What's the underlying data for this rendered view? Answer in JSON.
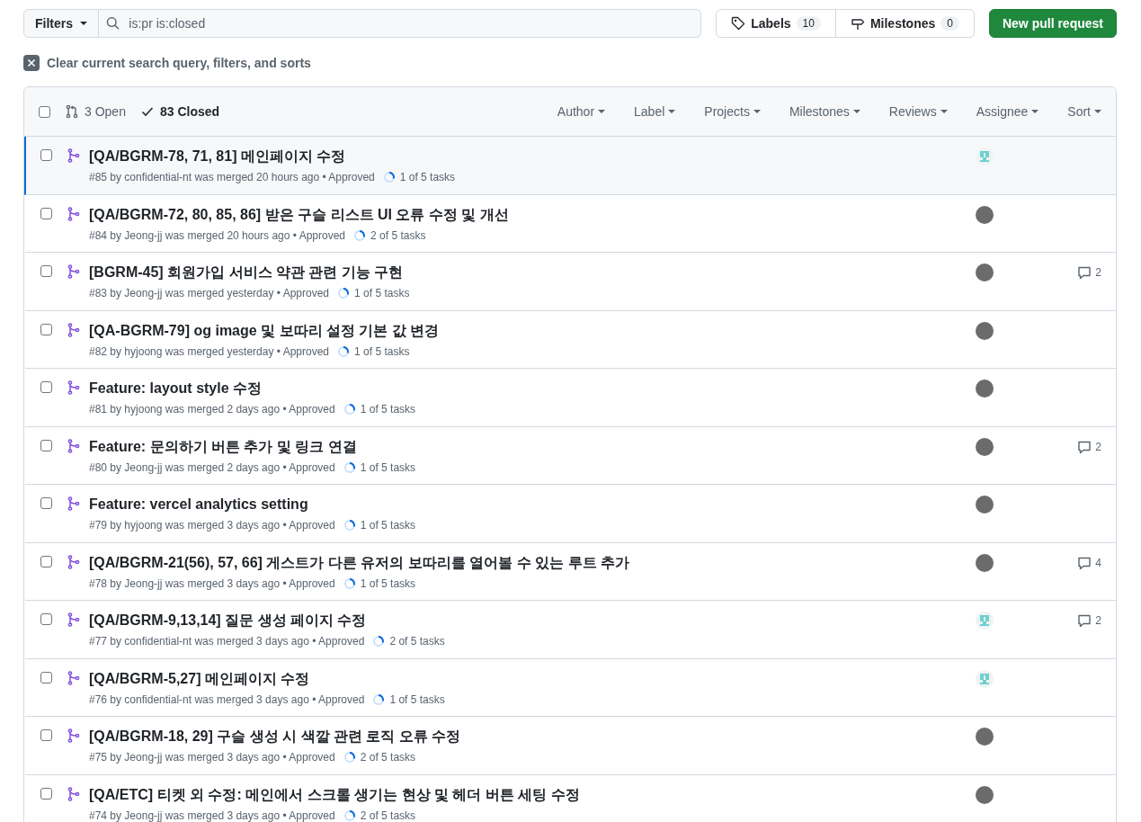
{
  "toolbar": {
    "filters_button": "Filters",
    "search": {
      "value": "is:pr is:closed"
    },
    "labels": {
      "label": "Labels",
      "count": "10"
    },
    "milestones": {
      "label": "Milestones",
      "count": "0"
    },
    "new_button": "New pull request"
  },
  "clear_filters": "Clear current search query, filters, and sorts",
  "list_header": {
    "checked": false,
    "states": [
      {
        "label": "3 Open",
        "selected": false
      },
      {
        "label": "83 Closed",
        "selected": true
      }
    ],
    "filters": [
      "Author",
      "Label",
      "Projects",
      "Milestones",
      "Reviews",
      "Assignee",
      "Sort"
    ]
  },
  "rows": [
    {
      "title": "[QA/BGRM-78, 71, 81] 메인페이지 수정",
      "meta": "#85 by confidential-nt was merged 20 hours ago • Approved",
      "tasks": "1 of 5 tasks",
      "kind": "identicon",
      "checked": false,
      "selected": true
    },
    {
      "title": "[QA/BGRM-72, 80, 85, 86] 받은 구슬 리스트 UI 오류 수정 및 개선",
      "meta": "#84 by Jeong-jj was merged 20 hours ago • Approved",
      "tasks": "2 of 5 tasks",
      "kind": "photo",
      "checked": false,
      "selected": false
    },
    {
      "title": "[BGRM-45] 회원가입 서비스 약관 관련 기능 구현",
      "meta": "#83 by Jeong-jj was merged yesterday • Approved",
      "tasks": "1 of 5 tasks",
      "kind": "photo",
      "comments": "2",
      "checked": false,
      "selected": false
    },
    {
      "title": "[QA-BGRM-79] og image 및 보따리 설정 기본 값 변경",
      "meta": "#82 by hyjoong was merged yesterday • Approved",
      "tasks": "1 of 5 tasks",
      "kind": "photo",
      "checked": false,
      "selected": false
    },
    {
      "title": "Feature: layout style 수정",
      "meta": "#81 by hyjoong was merged 2 days ago • Approved",
      "tasks": "1 of 5 tasks",
      "kind": "photo",
      "checked": false,
      "selected": false
    },
    {
      "title": "Feature: 문의하기 버튼 추가 및 링크 연결",
      "meta": "#80 by Jeong-jj was merged 2 days ago • Approved",
      "tasks": "1 of 5 tasks",
      "kind": "photo",
      "comments": "2",
      "checked": false,
      "selected": false
    },
    {
      "title": "Feature: vercel analytics setting",
      "meta": "#79 by hyjoong was merged 3 days ago • Approved",
      "tasks": "1 of 5 tasks",
      "kind": "photo",
      "checked": false,
      "selected": false
    },
    {
      "title": "[QA/BGRM-21(56), 57, 66] 게스트가 다른 유저의 보따리를 열어볼 수 있는 루트 추가",
      "meta": "#78 by Jeong-jj was merged 3 days ago • Approved",
      "tasks": "1 of 5 tasks",
      "kind": "photo",
      "comments": "4",
      "checked": false,
      "selected": false
    },
    {
      "title": "[QA/BGRM-9,13,14] 질문 생성 페이지 수정",
      "meta": "#77 by confidential-nt was merged 3 days ago • Approved",
      "tasks": "2 of 5 tasks",
      "kind": "identicon",
      "comments": "2",
      "checked": false,
      "selected": false
    },
    {
      "title": "[QA/BGRM-5,27] 메인페이지 수정",
      "meta": "#76 by confidential-nt was merged 3 days ago • Approved",
      "tasks": "1 of 5 tasks",
      "kind": "identicon",
      "checked": false,
      "selected": false
    },
    {
      "title": "[QA/BGRM-18, 29] 구슬 생성 시 색깔 관련 로직 오류 수정",
      "meta": "#75 by Jeong-jj was merged 3 days ago • Approved",
      "tasks": "2 of 5 tasks",
      "kind": "photo",
      "checked": false,
      "selected": false
    },
    {
      "title": "[QA/ETC] 티켓 외 수정: 메인에서 스크롤 생기는 현상 및 헤더 버튼 세팅 수정",
      "meta": "#74 by Jeong-jj was merged 3 days ago • Approved",
      "tasks": "2 of 5 tasks",
      "kind": "photo",
      "checked": false,
      "selected": false
    }
  ]
}
